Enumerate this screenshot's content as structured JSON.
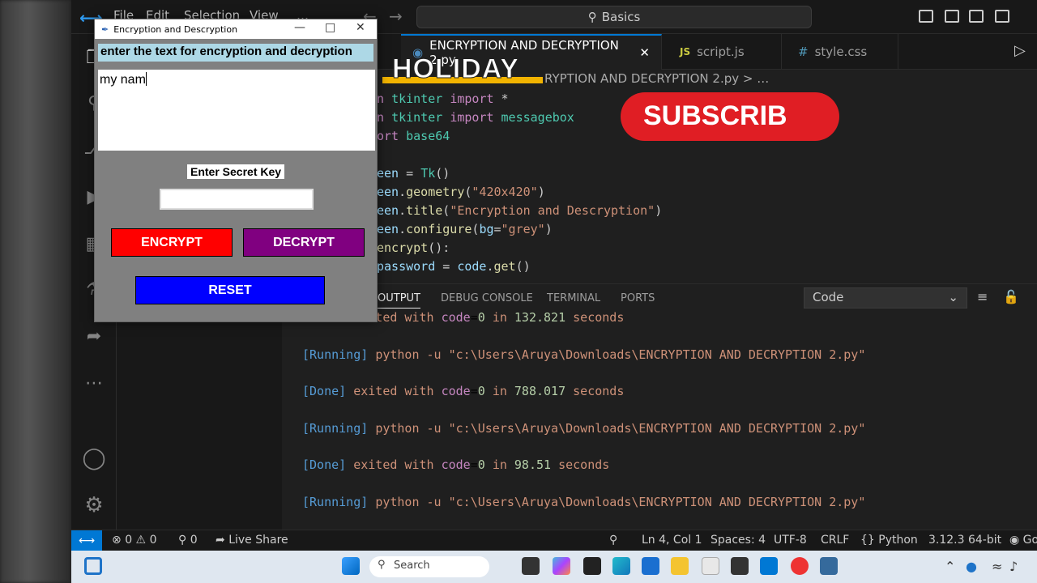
{
  "vscode": {
    "menu": [
      "File",
      "Edit",
      "Selection",
      "View",
      "…"
    ],
    "command_center": "Basics",
    "tabs": [
      {
        "label": "ENCRYPTION AND DECRYPTION 2.py",
        "active": true
      },
      {
        "label": "script.js",
        "active": false
      },
      {
        "label": "style.css",
        "active": false
      }
    ],
    "breadcrumb": "RYPTION AND DECRYPTION 2.py > …",
    "code_lines": [
      "n tkinter import *",
      "n tkinter import messagebox",
      "ort base64",
      "",
      "een = Tk()",
      "een.geometry(\"420x420\")",
      "een.title(\"Encryption and Descryption\")",
      "een.configure(bg=\"grey\")",
      "encrypt():",
      "password = code.get()"
    ],
    "panel": {
      "tabs": [
        "OUTPUT",
        "DEBUG CONSOLE",
        "TERMINAL",
        "PORTS"
      ],
      "active_tab": "OUTPUT",
      "selector_value": "Code",
      "output_lines": [
        {
          "type": "done_partial",
          "text": "[Done] exited with code=0 in 132.821 seconds"
        },
        {
          "type": "running",
          "text": "[Running] python -u \"c:\\Users\\Aruya\\Downloads\\ENCRYPTION AND DECRYPTION 2.py\""
        },
        {
          "type": "done",
          "text": "[Done] exited with code=0 in 788.017 seconds"
        },
        {
          "type": "running",
          "text": "[Running] python -u \"c:\\Users\\Aruya\\Downloads\\ENCRYPTION AND DECRYPTION 2.py\""
        },
        {
          "type": "done",
          "text": "[Done] exited with code=0 in 98.51 seconds"
        },
        {
          "type": "running",
          "text": "[Running] python -u \"c:\\Users\\Aruya\\Downloads\\ENCRYPTION AND DECRYPTION 2.py\""
        }
      ]
    },
    "status": {
      "errors": "0",
      "warnings": "0",
      "ports": "0",
      "live_share": "Live Share",
      "position": "Ln 4, Col 1",
      "spaces": "Spaces: 4",
      "encoding": "UTF-8",
      "eol": "CRLF",
      "language": "Python",
      "interpreter": "3.12.3 64-bit",
      "extra": "Go"
    }
  },
  "tk_window": {
    "title": "Encryption and Descryption",
    "heading": "enter the text for encryption and decryption",
    "text_value": "my nam",
    "key_label": "Enter Secret Key",
    "key_value": "",
    "encrypt_label": "ENCRYPT",
    "decrypt_label": "DECRYPT",
    "reset_label": "RESET",
    "colors": {
      "bg": "#808080",
      "encrypt": "#ff0000",
      "decrypt": "#800080",
      "reset": "#0000ff",
      "heading_bg": "#add8e6"
    }
  },
  "overlays": {
    "holiday": "HOLIDAY",
    "subscribe": "SUBSCRIB"
  },
  "taskbar": {
    "search_placeholder": "Search"
  }
}
